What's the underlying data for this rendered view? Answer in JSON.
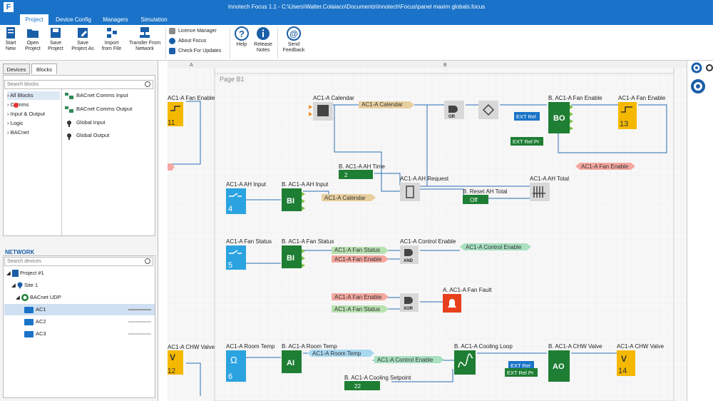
{
  "window": {
    "title": "Innotech Focus 1.1 - C:\\Users\\Walter.Colaiaco\\Documents\\Innotech\\Focus\\panel maxim globals.focus",
    "logo": "F"
  },
  "tabs": [
    "Project",
    "Device Config",
    "Managers",
    "Simulation"
  ],
  "ribbon": {
    "buttons": [
      {
        "l1": "Start",
        "l2": "New"
      },
      {
        "l1": "Open",
        "l2": "Project"
      },
      {
        "l1": "Save",
        "l2": "Project"
      },
      {
        "l1": "Save",
        "l2": "Project As"
      },
      {
        "l1": "Import",
        "l2": "from File"
      },
      {
        "l1": "Transfer From",
        "l2": "Network"
      },
      {
        "l1": "Help",
        "l2": ""
      },
      {
        "l1": "Release",
        "l2": "Notes"
      },
      {
        "l1": "Send",
        "l2": "Feedback"
      }
    ],
    "small": [
      "Licence Manager",
      "About Focus",
      "Check For Updates"
    ]
  },
  "panel": {
    "tabs": [
      "Devices",
      "Blocks"
    ],
    "search_blocks": "Search blocks",
    "categories": [
      "All Blocks",
      "Comms",
      "Input & Output",
      "Logic",
      "BACnet"
    ],
    "blocks": [
      "BACnet Comms Input",
      "BACnet Comms Output",
      "Global Input",
      "Global Output"
    ],
    "network_label": "NETWORK",
    "search_devices": "Search devices",
    "tree": [
      "Project #1",
      "Site 1",
      "BACnet UDP",
      "AC1",
      "AC2",
      "AC3"
    ]
  },
  "canvas": {
    "col_a": "A",
    "col_b": "B",
    "row_1": "1",
    "page_title": "Page B1",
    "labels": {
      "fan_enable_left": "AC1-A Fan Enable",
      "chw_valve_left": "AC1-A CHW Valve",
      "calendar": "AC1-A Calendar",
      "calendar_tag": "AC1-A Calendar",
      "bo_title": "B. AC1-A Fan Enable",
      "fan_enable_right": "AC1-A Fan Enable",
      "ext_rel": "EXT Rel",
      "ext_rel_pr": "EXT Rel Pr",
      "fan_enable_tag": "AC1-A Fan Enable",
      "ah_time": "B. AC1-A AH Time",
      "ah_time_val": "2",
      "ah_request": "AC1-A AH Request",
      "ah_total": "AC1-A AH Total",
      "reset_ah_total": "B. Reset AH Total",
      "reset_val": "Off",
      "ah_input": "AC1-A AH Input",
      "ah_input_num": "4",
      "bi_ah_title": "B. AC1-A AH Input",
      "calendar_tag2": "AC1-A Calendar",
      "fan_status": "AC1-A Fan Status",
      "fan_status_num": "5",
      "bi_fs_title": "B. AC1-A Fan Status",
      "fs_tag": "AC1-A Fan Status",
      "fe_tag": "AC1-A Fan Enable",
      "control_enable": "AC1-A Control Enable",
      "ce_tag": "AC1-A Control Enable",
      "fan_fault": "A. AC1-A Fan Fault",
      "fe_tag2": "AC1-A Fan Enable",
      "fs_tag2": "AC1-A Fan Status",
      "room_temp": "AC1-A Room Temp",
      "room_temp_num": "6",
      "ai_title": "B. AC1-A Room Temp",
      "rt_tag": "AC1-A Room Temp",
      "ce_tag2": "AC1-A Control Enable",
      "cooling_loop": "B. AC1-A Cooling Loop",
      "cooling_setpoint": "B. AC1-A Cooling Setpoint",
      "cs_val": "22",
      "ao_title": "B. AC1-A CHW Valve",
      "chw_valve_right": "AC1-A CHW Valve",
      "ext_rel2": "EXT Rel",
      "ext_rel_pr2": "EXT Rel Pr",
      "or": "OR",
      "and": "AND",
      "xor": "XOR",
      "bo": "BO",
      "bi": "BI",
      "ai": "AI",
      "ao": "AO",
      "num11": "11",
      "num13": "13",
      "num12": "12",
      "num14": "14"
    }
  },
  "colors": {
    "brand": "#1a73c8",
    "green": "#1e7e34",
    "yellow": "#f5b800",
    "blue": "#2ba3e0",
    "red": "#e8401c"
  }
}
